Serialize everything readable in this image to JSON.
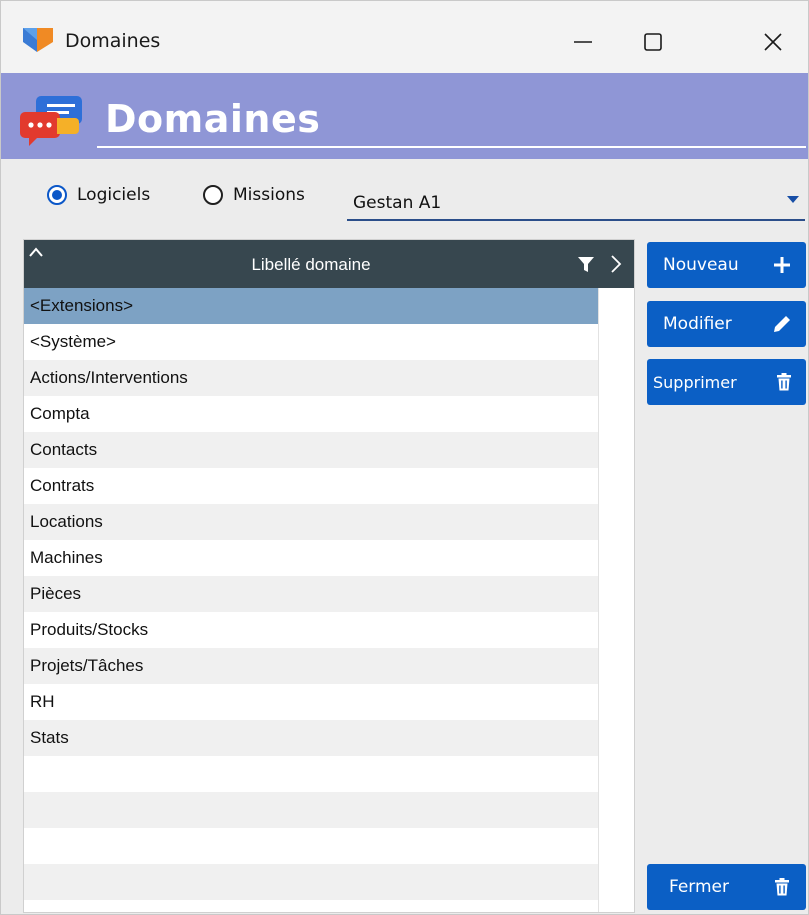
{
  "window": {
    "title": "Domaines"
  },
  "header": {
    "title": "Domaines"
  },
  "filters": {
    "radio_options": [
      {
        "label": "Logiciels",
        "checked": true
      },
      {
        "label": "Missions",
        "checked": false
      }
    ],
    "combo_value": "Gestan A1"
  },
  "table": {
    "column_header": "Libellé domaine",
    "rows": [
      "<Extensions>",
      "<Système>",
      "Actions/Interventions",
      "Compta",
      "Contacts",
      "Contrats",
      "Locations",
      "Machines",
      "Pièces",
      "Produits/Stocks",
      "Projets/Tâches",
      "RH",
      "Stats",
      "",
      "",
      "",
      ""
    ],
    "selected_index": 0
  },
  "buttons": {
    "nouveau": "Nouveau",
    "modifier": "Modifier",
    "supprimer": "Supprimer",
    "fermer": "Fermer"
  },
  "colors": {
    "header_band": "#8f96d6",
    "accent_button": "#0b5fc5",
    "table_header": "#37474f",
    "row_selected": "#7da2c4"
  },
  "icons": {
    "app": "app-logo-icon",
    "header": "chat-bubbles-icon",
    "nouveau": "plus-icon",
    "modifier": "pencil-icon",
    "supprimer": "trash-icon",
    "fermer": "trash-icon"
  }
}
